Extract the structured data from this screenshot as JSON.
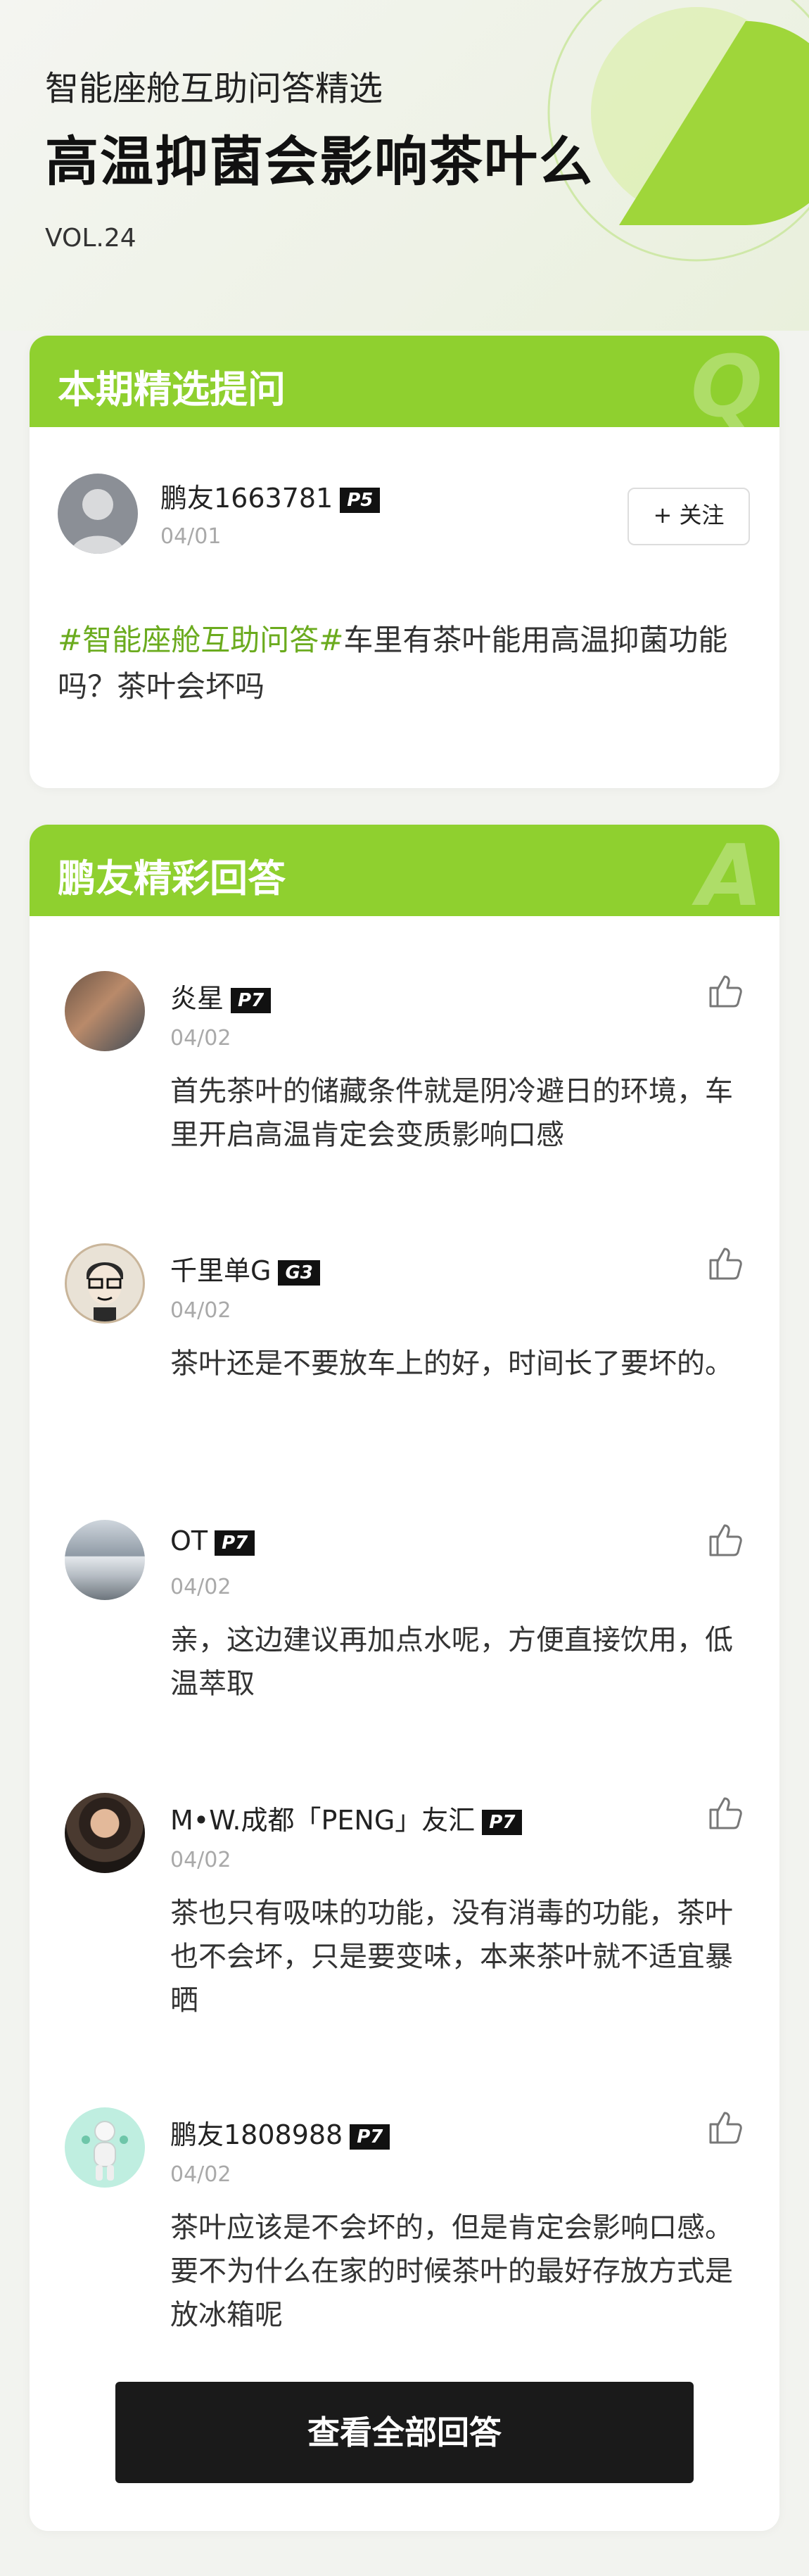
{
  "header": {
    "subtitle": "智能座舱互助问答精选",
    "title": "高温抑菌会影响茶叶么",
    "volume": "VOL.24",
    "accent_color": "#8fd02f"
  },
  "question_section": {
    "heading": "本期精选提问",
    "watermark": "Q",
    "user": {
      "name": "鹏友1663781",
      "badge": "P5",
      "date": "04/01",
      "avatar": "default-avatar-icon"
    },
    "follow_label": "+ 关注",
    "tag": "#智能座舱互助问答#",
    "text": "车里有茶叶能用高温抑菌功能吗？茶叶会坏吗"
  },
  "answer_section": {
    "heading": "鹏友精彩回答",
    "watermark": "A",
    "answers": [
      {
        "name": "炎星",
        "badge": "P7",
        "date": "04/02",
        "text": "首先茶叶的储藏条件就是阴冷避日的环境，车里开启高温肯定会变质影响口感"
      },
      {
        "name": "千里单G",
        "badge": "G3",
        "date": "04/02",
        "text": "茶叶还是不要放车上的好，时间长了要坏的。"
      },
      {
        "name": "OT",
        "badge": "P7",
        "date": "04/02",
        "text": "亲，这边建议再加点水呢，方便直接饮用，低温萃取"
      },
      {
        "name": "M•W.成都「PENG」友汇",
        "badge": "P7",
        "date": "04/02",
        "text": "茶也只有吸味的功能，没有消毒的功能，茶叶也不会坏，只是要变味，本来茶叶就不适宜暴晒"
      },
      {
        "name": "鹏友1808988",
        "badge": "P7",
        "date": "04/02",
        "text": "茶叶应该是不会坏的，但是肯定会影响口感。要不为什么在家的时候茶叶的最好存放方式是放冰箱呢"
      }
    ],
    "view_all_label": "查看全部回答"
  }
}
